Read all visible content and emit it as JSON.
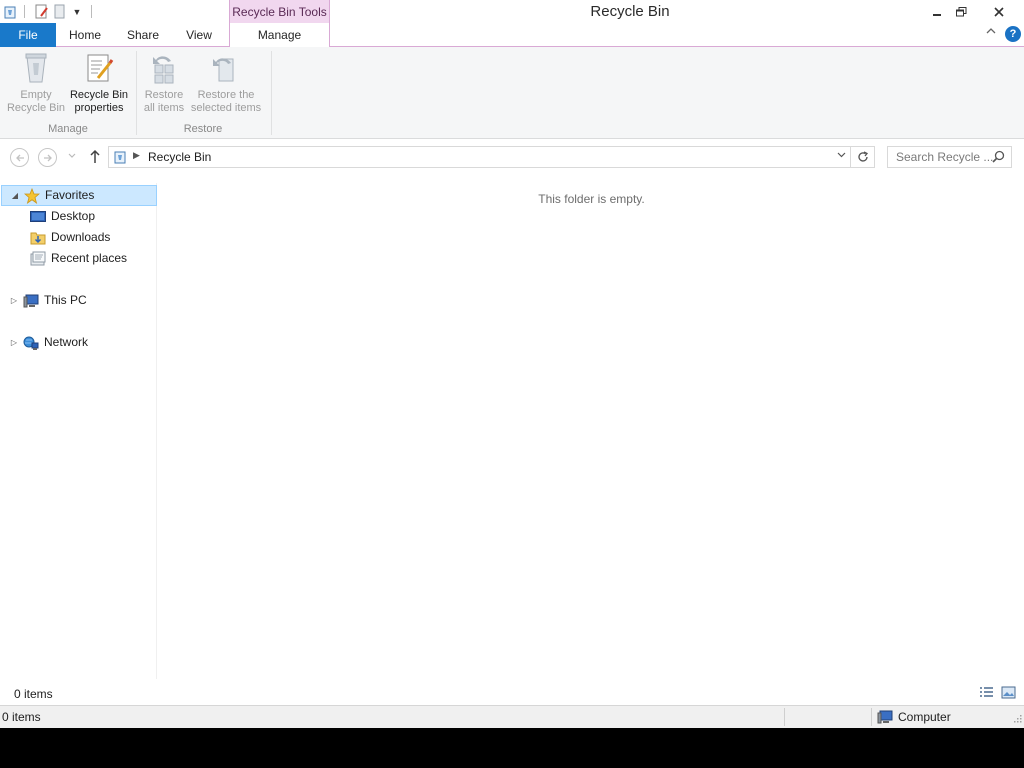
{
  "window": {
    "title": "Recycle Bin",
    "context_tab_group": "Recycle Bin Tools",
    "controls": {
      "minimize_icon": "minimize-icon",
      "restore_icon": "restore-icon",
      "close_icon": "close-icon"
    }
  },
  "quick_access": {
    "icons": [
      "recycle-bin-small-icon",
      "properties-icon",
      "new-folder-icon",
      "customize-dropdown-icon"
    ]
  },
  "ribbon": {
    "tabs": [
      {
        "label": "File"
      },
      {
        "label": "Home"
      },
      {
        "label": "Share"
      },
      {
        "label": "View"
      },
      {
        "label": "Manage"
      }
    ],
    "active_tab": "Manage",
    "groups": [
      {
        "label": "Manage",
        "buttons": [
          {
            "line1": "Empty",
            "line2": "Recycle Bin",
            "enabled": false
          },
          {
            "line1": "Recycle Bin",
            "line2": "properties",
            "enabled": true
          }
        ]
      },
      {
        "label": "Restore",
        "buttons": [
          {
            "line1": "Restore",
            "line2": "all items",
            "enabled": false
          },
          {
            "line1": "Restore the",
            "line2": "selected items",
            "enabled": false
          }
        ]
      }
    ],
    "help_label": "?"
  },
  "address_bar": {
    "path": "Recycle Bin",
    "search_placeholder": "Search Recycle ..."
  },
  "navigation_pane": {
    "favorites": {
      "label": "Favorites",
      "expanded": true
    },
    "favorite_items": [
      {
        "label": "Desktop",
        "icon": "desktop-icon"
      },
      {
        "label": "Downloads",
        "icon": "downloads-folder-icon"
      },
      {
        "label": "Recent places",
        "icon": "recent-places-icon"
      }
    ],
    "this_pc": {
      "label": "This PC",
      "expanded": false
    },
    "network": {
      "label": "Network",
      "expanded": false
    }
  },
  "content": {
    "empty_message": "This folder is empty."
  },
  "status": {
    "item_count": "0 items",
    "bottom_item_count": "0 items",
    "zone": "Computer"
  },
  "colors": {
    "file_tab": "#1979ca",
    "context_tab": "#f1d7ef",
    "selection": "#cce8ff"
  }
}
